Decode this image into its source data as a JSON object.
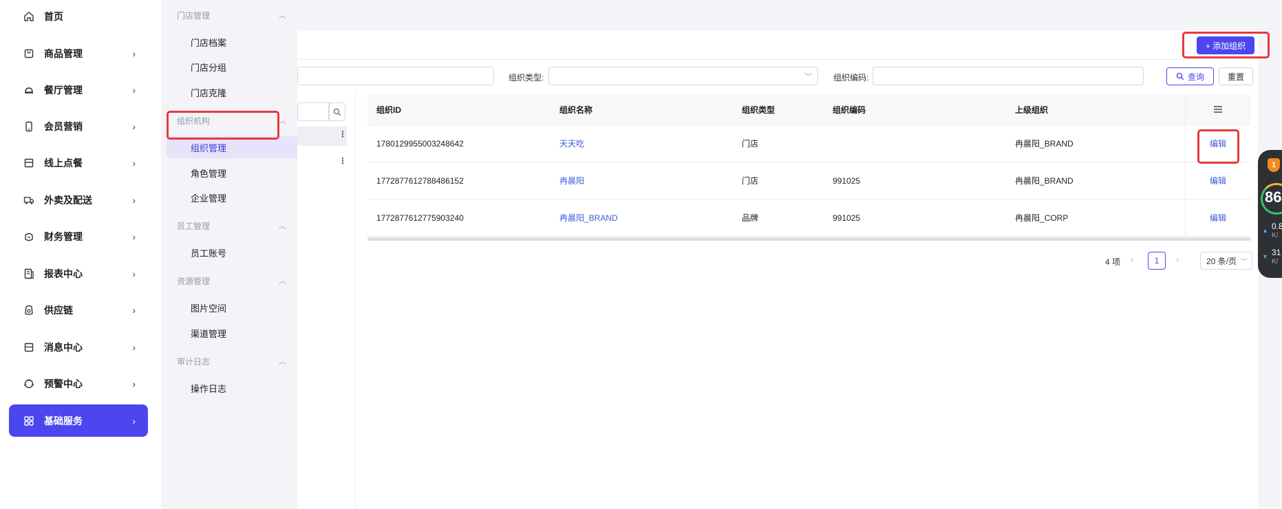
{
  "sidebar": {
    "items": [
      {
        "label": "首页",
        "icon": "home-icon",
        "has_chevron": false
      },
      {
        "label": "商品管理",
        "icon": "bag-icon",
        "has_chevron": true
      },
      {
        "label": "餐厅管理",
        "icon": "cloche-icon",
        "has_chevron": true
      },
      {
        "label": "会员营销",
        "icon": "phone-icon",
        "has_chevron": true
      },
      {
        "label": "线上点餐",
        "icon": "store-icon",
        "has_chevron": true
      },
      {
        "label": "外卖及配送",
        "icon": "truck-icon",
        "has_chevron": true
      },
      {
        "label": "财务管理",
        "icon": "wallet-icon",
        "has_chevron": true
      },
      {
        "label": "报表中心",
        "icon": "report-icon",
        "has_chevron": true
      },
      {
        "label": "供应链",
        "icon": "supply-icon",
        "has_chevron": true
      },
      {
        "label": "消息中心",
        "icon": "message-icon",
        "has_chevron": true
      },
      {
        "label": "预警中心",
        "icon": "alert-icon",
        "has_chevron": true
      },
      {
        "label": "基础服务",
        "icon": "grid-icon",
        "has_chevron": true,
        "active": true
      }
    ]
  },
  "submenu": {
    "groups": [
      {
        "label": "门店管理",
        "items": [
          "门店档案",
          "门店分组",
          "门店克隆"
        ]
      },
      {
        "label": "组织机构",
        "items": [
          "组织管理",
          "角色管理",
          "企业管理"
        ]
      },
      {
        "label": "员工管理",
        "items": [
          "员工账号"
        ]
      },
      {
        "label": "资源管理",
        "items": [
          "图片空间",
          "渠道管理"
        ]
      },
      {
        "label": "审计日志",
        "items": [
          "操作日志"
        ]
      }
    ],
    "active_item": "组织管理"
  },
  "toolbar": {
    "add_button": "+ 添加组织"
  },
  "filters": {
    "org_type_label": "组织类型:",
    "org_code_label": "组织编码:",
    "query_button": "查询",
    "reset_button": "重置"
  },
  "table": {
    "columns": [
      "组织ID",
      "组织名称",
      "组织类型",
      "组织编码",
      "上级组织"
    ],
    "rows": [
      {
        "id": "1780129955003248642",
        "name": "天天吃",
        "type": "门店",
        "code": "",
        "parent": "冉晨阳_BRAND",
        "action": "编辑"
      },
      {
        "id": "1772877612788486152",
        "name": "冉晨阳",
        "type": "门店",
        "code": "991025",
        "parent": "冉晨阳_BRAND",
        "action": "编辑"
      },
      {
        "id": "1772877612775903240",
        "name": "冉晨阳_BRAND",
        "type": "品牌",
        "code": "991025",
        "parent": "冉晨阳_CORP",
        "action": "编辑"
      }
    ]
  },
  "pagination": {
    "total": "4 项",
    "current_page": "1",
    "page_size": "20 条/页"
  },
  "widget": {
    "badge": "1",
    "score": "86",
    "upload": "0.8",
    "upload_unit": "K/",
    "download": "31",
    "download_unit": "K/"
  },
  "colors": {
    "accent": "#4c46ef",
    "link": "#3d5bd9",
    "highlight_box": "#e5393e"
  }
}
